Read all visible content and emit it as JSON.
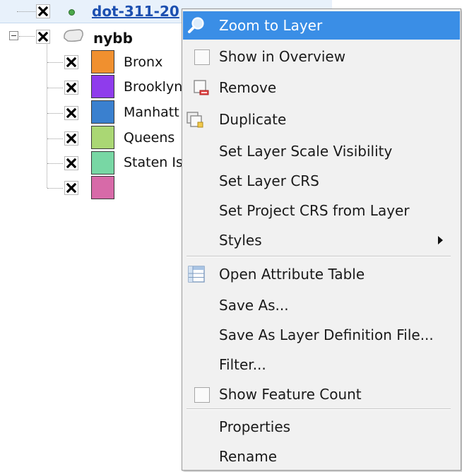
{
  "layer_tree": {
    "selected_layer": {
      "name": "dot-311-20"
    },
    "group": {
      "name": "nybb"
    },
    "symbols": [
      {
        "label": "Bronx",
        "color": "#f0902f"
      },
      {
        "label": "Brooklyn",
        "color": "#8f3cec"
      },
      {
        "label": "Manhatt",
        "color": "#3a80cf"
      },
      {
        "label": "Queens",
        "color": "#aad774"
      },
      {
        "label": "Staten Is",
        "color": "#78d7a4"
      },
      {
        "label": "",
        "color": "#d76aa8"
      }
    ]
  },
  "context_menu": {
    "highlight_color": "#3a8ee6",
    "items": [
      {
        "label": "Zoom to Layer",
        "icon": "zoom-magnifier-icon",
        "highlighted": true
      },
      {
        "label": "Show in Overview",
        "icon": "checkbox-unchecked"
      },
      {
        "label": "Remove",
        "icon": "remove-layer-icon"
      },
      {
        "label": "Duplicate",
        "icon": "duplicate-layer-icon"
      },
      {
        "label": "Set Layer Scale Visibility"
      },
      {
        "label": "Set Layer CRS"
      },
      {
        "label": "Set Project CRS from Layer"
      },
      {
        "label": "Styles",
        "submenu": true
      },
      {
        "label": "Open Attribute Table",
        "icon": "attribute-table-icon"
      },
      {
        "label": "Save As..."
      },
      {
        "label": "Save As Layer Definition File..."
      },
      {
        "label": "Filter..."
      },
      {
        "label": "Show Feature Count",
        "icon": "checkbox-unchecked"
      },
      {
        "label": "Properties"
      },
      {
        "label": "Rename"
      }
    ]
  }
}
